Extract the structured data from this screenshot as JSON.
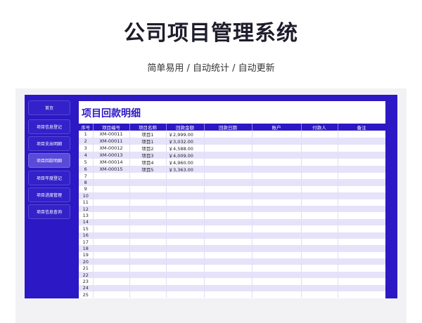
{
  "header": {
    "title": "公司项目管理系统",
    "subtitle": "简单易用 / 自动统计 / 自动更新"
  },
  "sidebar": {
    "items": [
      {
        "label": "首页"
      },
      {
        "label": "项目信息登记"
      },
      {
        "label": "项目支出明细"
      },
      {
        "label": "项目回款明细"
      },
      {
        "label": "项目年度登记"
      },
      {
        "label": "项目进度管理"
      },
      {
        "label": "项目信息查询"
      }
    ],
    "active_index": 3
  },
  "main": {
    "title": "项目回款明细",
    "columns": [
      "序号",
      "项目编号",
      "项目名称",
      "回款金额",
      "回款日期",
      "账户",
      "付款人",
      "备注"
    ],
    "rows": [
      [
        "1",
        "XM-00011",
        "项目1",
        "￥2,999.00",
        "",
        "",
        "",
        ""
      ],
      [
        "2",
        "XM-00011",
        "项目1",
        "￥3,032.00",
        "",
        "",
        "",
        ""
      ],
      [
        "3",
        "XM-00012",
        "项目2",
        "￥4,588.00",
        "",
        "",
        "",
        ""
      ],
      [
        "4",
        "XM-00013",
        "项目3",
        "￥4,009.00",
        "",
        "",
        "",
        ""
      ],
      [
        "5",
        "XM-00014",
        "项目4",
        "￥4,960.00",
        "",
        "",
        "",
        ""
      ],
      [
        "6",
        "XM-00015",
        "项目5",
        "￥3,363.00",
        "",
        "",
        "",
        ""
      ],
      [
        "7",
        "",
        "",
        "",
        "",
        "",
        "",
        ""
      ],
      [
        "8",
        "",
        "",
        "",
        "",
        "",
        "",
        ""
      ],
      [
        "9",
        "",
        "",
        "",
        "",
        "",
        "",
        ""
      ],
      [
        "10",
        "",
        "",
        "",
        "",
        "",
        "",
        ""
      ],
      [
        "11",
        "",
        "",
        "",
        "",
        "",
        "",
        ""
      ],
      [
        "12",
        "",
        "",
        "",
        "",
        "",
        "",
        ""
      ],
      [
        "13",
        "",
        "",
        "",
        "",
        "",
        "",
        ""
      ],
      [
        "14",
        "",
        "",
        "",
        "",
        "",
        "",
        ""
      ],
      [
        "15",
        "",
        "",
        "",
        "",
        "",
        "",
        ""
      ],
      [
        "16",
        "",
        "",
        "",
        "",
        "",
        "",
        ""
      ],
      [
        "17",
        "",
        "",
        "",
        "",
        "",
        "",
        ""
      ],
      [
        "18",
        "",
        "",
        "",
        "",
        "",
        "",
        ""
      ],
      [
        "19",
        "",
        "",
        "",
        "",
        "",
        "",
        ""
      ],
      [
        "20",
        "",
        "",
        "",
        "",
        "",
        "",
        ""
      ],
      [
        "21",
        "",
        "",
        "",
        "",
        "",
        "",
        ""
      ],
      [
        "22",
        "",
        "",
        "",
        "",
        "",
        "",
        ""
      ],
      [
        "23",
        "",
        "",
        "",
        "",
        "",
        "",
        ""
      ],
      [
        "24",
        "",
        "",
        "",
        "",
        "",
        "",
        ""
      ],
      [
        "25",
        "",
        "",
        "",
        "",
        "",
        "",
        ""
      ]
    ]
  },
  "colors": {
    "accent": "#2c18c4",
    "row_stripe": "#e6e2fa"
  }
}
